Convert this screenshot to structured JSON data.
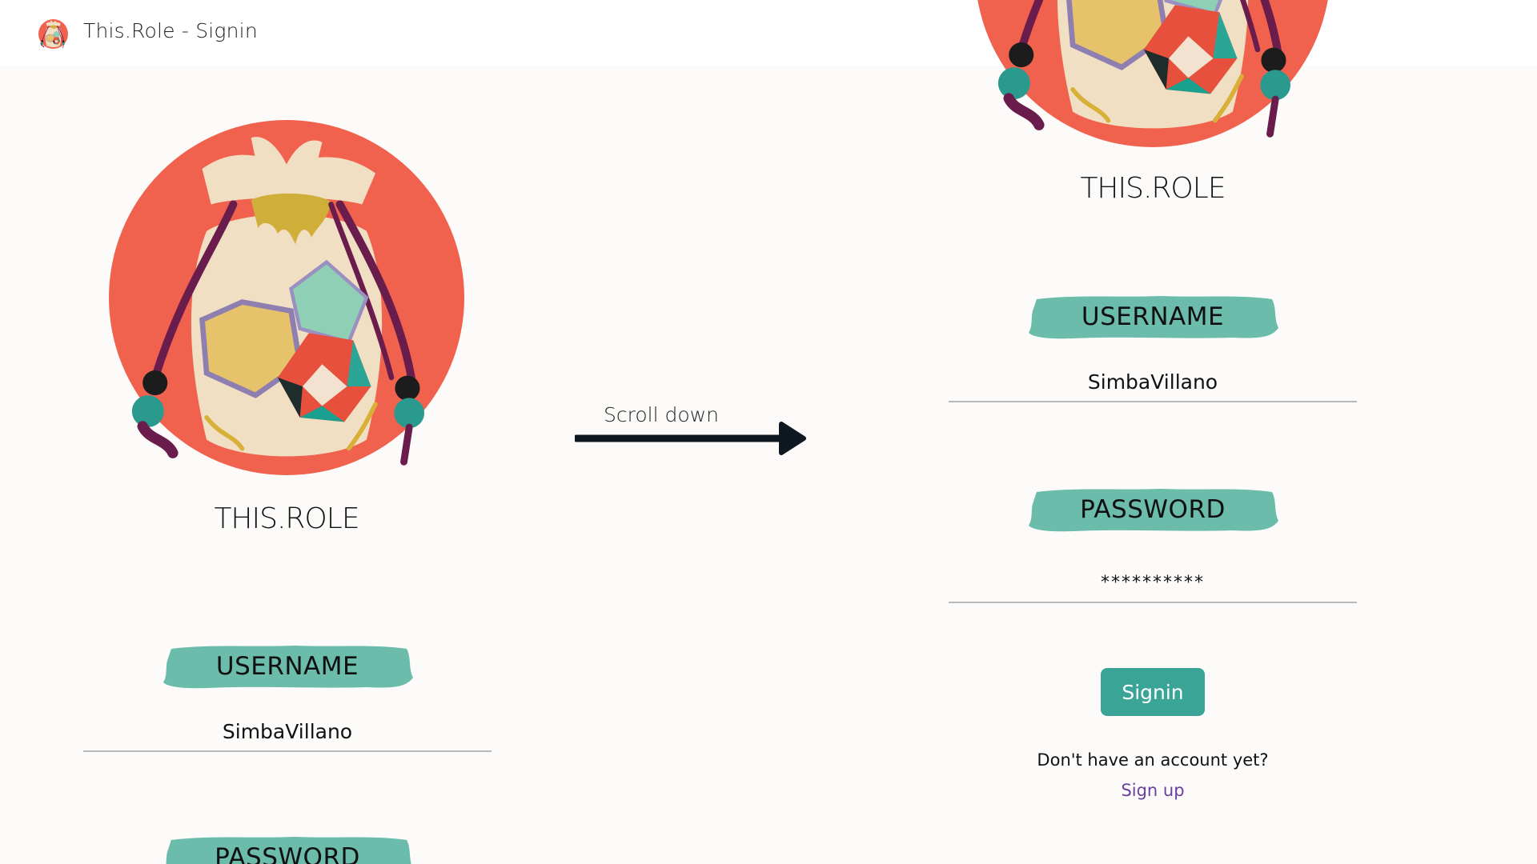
{
  "tab": {
    "title": "This.Role - Signin",
    "favicon": "dice-bag-favicon-icon"
  },
  "left_panel": {
    "brand": "THIS.ROLE",
    "logo": "dice-bag-logo",
    "username_label": "USERNAME",
    "username_value": "SimbaVillano",
    "password_label": "PASSWORD"
  },
  "annotation": {
    "text": "Scroll down",
    "icon": "right-arrow-icon"
  },
  "right_panel": {
    "brand": "THIS.ROLE",
    "logo": "dice-bag-logo",
    "username_label": "USERNAME",
    "username_value": "SimbaVillano",
    "password_label": "PASSWORD",
    "password_value": "**********",
    "signin_label": "Signin",
    "signup_prompt": "Don't have an account yet?",
    "signup_link": "Sign up"
  },
  "colors": {
    "background": "#fcfbf9",
    "logo_circle": "#f1624e",
    "bag": "#f1dfc4",
    "label_brush": "#6bbcab",
    "signin_button": "#3aa496",
    "link": "#6b3fa0",
    "field_underline": "#b8b8b8"
  }
}
